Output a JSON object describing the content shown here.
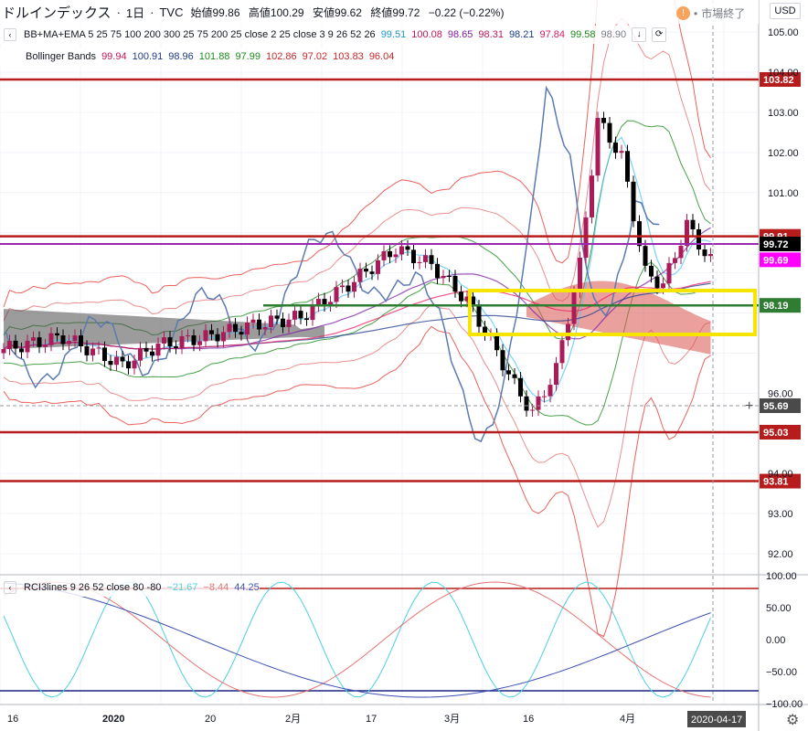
{
  "header": {
    "symbol": "ドルインデックス",
    "interval": "1日",
    "source": "TVC",
    "open_label": "始値",
    "open": "99.86",
    "high_label": "高値",
    "high": "100.29",
    "low_label": "安値",
    "low": "99.62",
    "close_label": "終値",
    "close": "99.72",
    "change": "−0.22 (−0.22%)",
    "market_status": "市場終了",
    "currency": "USD"
  },
  "indicators": {
    "ma_label": "BB+MA+EMA 5 25 75 100 200 300 25 75 200 25 close 2 25 close 3 9 26 52 26",
    "ma_values": [
      {
        "text": "99.51",
        "color": "#2196c9"
      },
      {
        "text": "100.08",
        "color": "#c2185b"
      },
      {
        "text": "98.65",
        "color": "#7b1fa2"
      },
      {
        "text": "98.31",
        "color": "#c2185b"
      },
      {
        "text": "98.21",
        "color": "#1e3a8a"
      },
      {
        "text": "97.84",
        "color": "#d81b60"
      },
      {
        "text": "99.58",
        "color": "#1b8a1b"
      },
      {
        "text": "98.90",
        "color": "#787b86"
      }
    ],
    "bb_label": "Bollinger Bands",
    "bb_values": [
      {
        "text": "99.94",
        "color": "#c2185b"
      },
      {
        "text": "100.91",
        "color": "#1e3a8a"
      },
      {
        "text": "98.96",
        "color": "#1e3a8a"
      },
      {
        "text": "101.88",
        "color": "#1b8a1b"
      },
      {
        "text": "97.99",
        "color": "#1b8a1b"
      },
      {
        "text": "102.86",
        "color": "#c62828"
      },
      {
        "text": "97.02",
        "color": "#c62828"
      },
      {
        "text": "103.83",
        "color": "#c62828"
      },
      {
        "text": "96.04",
        "color": "#c62828"
      }
    ],
    "rci_label": "RCI3lines 9 26 52 close 80 -80",
    "rci_values": [
      {
        "text": "−21.67",
        "color": "#4dd0e1"
      },
      {
        "text": "−8.44",
        "color": "#e57373"
      },
      {
        "text": "44.25",
        "color": "#3f51b5"
      }
    ]
  },
  "chart_data": {
    "type": "candlestick",
    "ylim": [
      91.5,
      105.8
    ],
    "yticks": [
      "105.00",
      "104.00",
      "103.00",
      "102.00",
      "101.00",
      "96.00",
      "94.00",
      "93.00",
      "92.00"
    ],
    "xticks": [
      "16",
      "2020",
      "20",
      "2月",
      "17",
      "3月",
      "16",
      "4月",
      "2020-04-17"
    ],
    "horizontal_lines": [
      {
        "value": 103.82,
        "label": "103.82",
        "color": "#b71c1c"
      },
      {
        "value": 99.91,
        "label": "99.91",
        "color": "#b71c1c"
      },
      {
        "value": 95.03,
        "label": "95.03",
        "color": "#b71c1c"
      },
      {
        "value": 93.81,
        "label": "93.81",
        "color": "#b71c1c"
      },
      {
        "value": 98.19,
        "label": "98.19",
        "color": "#2e7d32"
      }
    ],
    "price_labels": [
      {
        "value": 99.72,
        "label": "99.72",
        "bg": "#000000",
        "fg": "#ffffff"
      },
      {
        "value": 99.69,
        "label": "99.69",
        "bg": "#ff00ff",
        "fg": "#ffffff"
      },
      {
        "value": 95.69,
        "label": "95.69",
        "bg": "#4a4a4a",
        "fg": "#ffffff"
      }
    ],
    "rci_panel": {
      "ylim": [
        -100,
        100
      ],
      "yticks": [
        "100.00",
        "50.00",
        "0.00",
        "−50.00",
        "−100.00"
      ],
      "levels": [
        80,
        -80
      ]
    }
  },
  "colors": {
    "up": "#ab1a59",
    "down": "#000000",
    "highlight_box": "#f5e500",
    "cloud_red": "#d9534f",
    "cloud_gray": "#4a4a4a"
  }
}
